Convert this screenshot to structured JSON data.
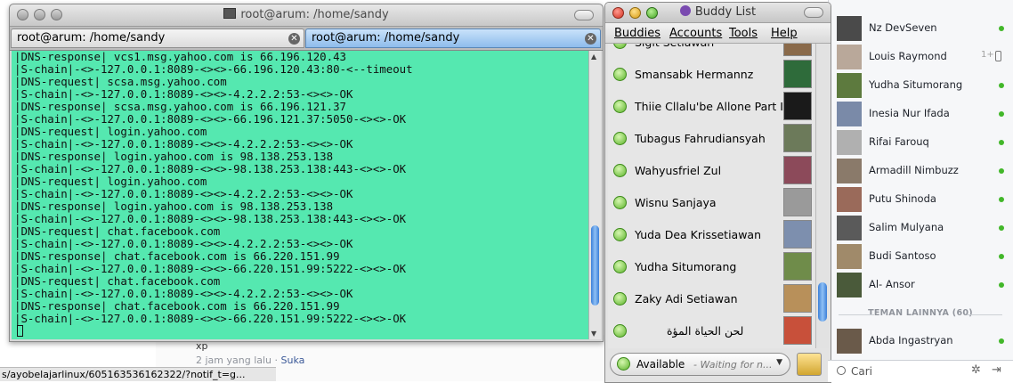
{
  "background": {
    "post_line": "xp",
    "post_meta_time": "2 jam yang lalu",
    "post_meta_sep": " · ",
    "post_meta_like": "Suka",
    "statusbar_url": "s/ayobelajarlinux/605163536162322/?notif_t=g..."
  },
  "terminal": {
    "title": "root@arum: /home/sandy",
    "tabs": [
      {
        "label": "root@arum: /home/sandy"
      },
      {
        "label": "root@arum: /home/sandy"
      }
    ],
    "lines": [
      "|DNS-response| vcs1.msg.yahoo.com is 66.196.120.43",
      "|S-chain|-<>-127.0.0.1:8089-<><>-66.196.120.43:80-<--timeout",
      "|DNS-request| scsa.msg.yahoo.com",
      "|S-chain|-<>-127.0.0.1:8089-<><>-4.2.2.2:53-<><>-OK",
      "|DNS-response| scsa.msg.yahoo.com is 66.196.121.37",
      "|S-chain|-<>-127.0.0.1:8089-<><>-66.196.121.37:5050-<><>-OK",
      "|DNS-request| login.yahoo.com",
      "|S-chain|-<>-127.0.0.1:8089-<><>-4.2.2.2:53-<><>-OK",
      "|DNS-response| login.yahoo.com is 98.138.253.138",
      "|S-chain|-<>-127.0.0.1:8089-<><>-98.138.253.138:443-<><>-OK",
      "|DNS-request| login.yahoo.com",
      "|S-chain|-<>-127.0.0.1:8089-<><>-4.2.2.2:53-<><>-OK",
      "|DNS-response| login.yahoo.com is 98.138.253.138",
      "|S-chain|-<>-127.0.0.1:8089-<><>-98.138.253.138:443-<><>-OK",
      "|DNS-request| chat.facebook.com",
      "|S-chain|-<>-127.0.0.1:8089-<><>-4.2.2.2:53-<><>-OK",
      "|DNS-response| chat.facebook.com is 66.220.151.99",
      "|S-chain|-<>-127.0.0.1:8089-<><>-66.220.151.99:5222-<><>-OK",
      "|DNS-request| chat.facebook.com",
      "|S-chain|-<>-127.0.0.1:8089-<><>-4.2.2.2:53-<><>-OK",
      "|DNS-response| chat.facebook.com is 66.220.151.99",
      "|S-chain|-<>-127.0.0.1:8089-<><>-66.220.151.99:5222-<><>-OK"
    ],
    "bg_color": "#55e8b0"
  },
  "buddy_list": {
    "title": "Buddy List",
    "menu": [
      "Buddies",
      "Accounts",
      "Tools",
      "Help"
    ],
    "partial_top": "Sigit Setiawan",
    "buddies": [
      {
        "name": "Smansabk Hermannz",
        "pic": "#2e6b3a"
      },
      {
        "name": "Thiie Cllalu'be Allone Part II",
        "pic": "#1a1a1a"
      },
      {
        "name": "Tubagus Fahrudiansyah",
        "pic": "#6c7a5a"
      },
      {
        "name": "Wahyusfriel Zul",
        "pic": "#8c4a5a"
      },
      {
        "name": "Wisnu Sanjaya",
        "pic": "#9a9a9a"
      },
      {
        "name": "Yuda Dea Krissetiawan",
        "pic": "#7d8fae"
      },
      {
        "name": "Yudha Situmorang",
        "pic": "#6f8c4a"
      },
      {
        "name": "Zaky Adi Setiawan",
        "pic": "#b8905a"
      },
      {
        "name": "لحن الحياة المؤة",
        "pic": "#c8503a"
      }
    ],
    "status_label": "Available",
    "status_sub": "- Waiting for n...",
    "accent": "#3b7fd8"
  },
  "fb_chat": {
    "contacts": [
      {
        "name": "Nz DevSeven",
        "presence": "online",
        "avatar": "#4a4a4a"
      },
      {
        "name": "Louis Raymond",
        "presence": "mobile",
        "since": "1+",
        "avatar": "#b9a89a"
      },
      {
        "name": "Yudha Situmorang",
        "presence": "online",
        "avatar": "#5d7a3e"
      },
      {
        "name": "Inesia Nur Ifada",
        "presence": "online",
        "avatar": "#7a8aa8"
      },
      {
        "name": "Rifai Farouq",
        "presence": "online",
        "avatar": "#b0b0b0"
      },
      {
        "name": "Armadill Nimbuzz",
        "presence": "online",
        "avatar": "#8a7a6a"
      },
      {
        "name": "Putu Shinoda",
        "presence": "online",
        "avatar": "#9a6a5a"
      },
      {
        "name": "Salim Mulyana",
        "presence": "online",
        "avatar": "#5a5a5a"
      },
      {
        "name": "Budi Santoso",
        "presence": "online",
        "avatar": "#a08a6a"
      },
      {
        "name": "Al- Ansor",
        "presence": "online",
        "avatar": "#4a5a3a"
      }
    ],
    "section_label": "TEMAN LAINNYA (60)",
    "other": [
      {
        "name": "Abda Ingastryan",
        "presence": "online",
        "avatar": "#6a5a4a"
      }
    ],
    "search_placeholder": "Cari",
    "online_color": "#42b72a"
  }
}
